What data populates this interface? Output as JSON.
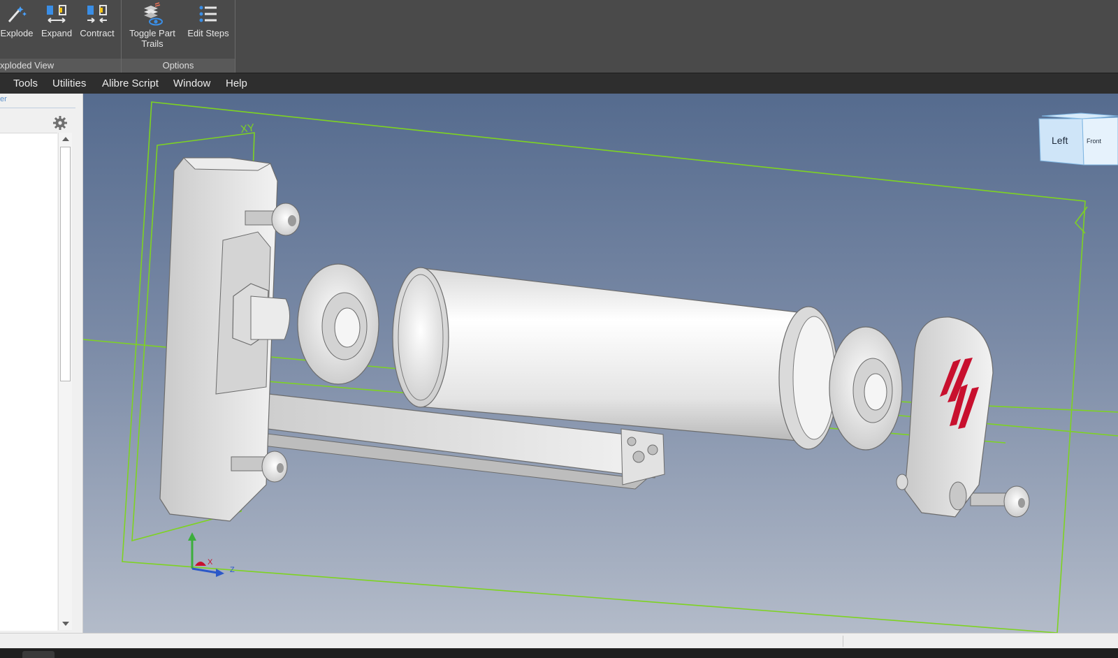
{
  "ribbon": {
    "exploded_view_group": {
      "label": "xploded View",
      "buttons": {
        "explode": "Explode",
        "expand": "Expand",
        "contract": "Contract"
      }
    },
    "options_group": {
      "label": "Options",
      "buttons": {
        "toggle_trails_line1": "Toggle Part",
        "toggle_trails_line2": "Trails",
        "edit_steps": "Edit Steps"
      }
    }
  },
  "menu": [
    "Tools",
    "Utilities",
    "Alibre Script",
    "Window",
    "Help"
  ],
  "left_panel": {
    "tab_fragment": "er",
    "settings_icon": "gear-icon"
  },
  "viewport": {
    "plane_label": "XY",
    "view_cube": {
      "left_face": "Left",
      "front_face": "Front"
    },
    "triad": {
      "x": "X",
      "z": "Z"
    }
  },
  "colors": {
    "ribbon": "#4a4a4a",
    "menubar": "#2e2e2e",
    "plane": "#7ed321",
    "accent_blue": "#3a8ee6",
    "logo_red": "#c8102e"
  }
}
